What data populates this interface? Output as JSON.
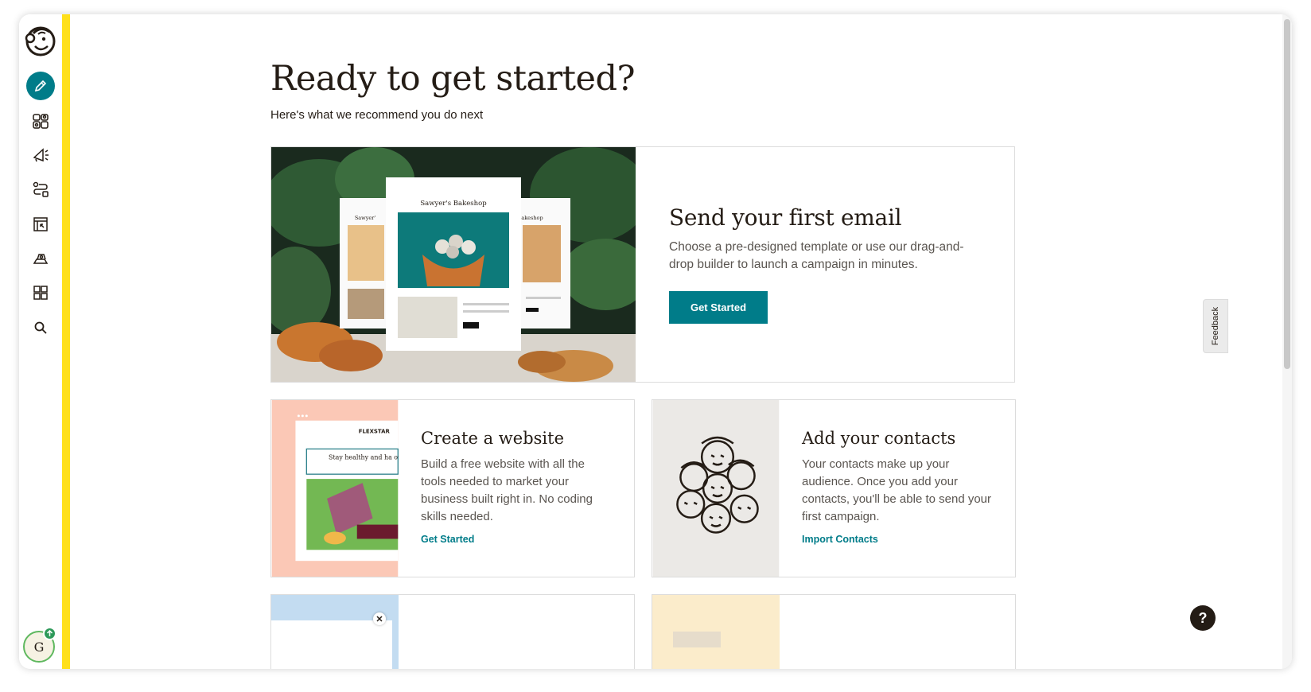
{
  "header": {
    "title": "Ready to get started?",
    "subtitle": "Here's what we recommend you do next"
  },
  "hero": {
    "title": "Send your first email",
    "description": "Choose a pre-designed template or use our drag-and-drop builder to launch a campaign in minutes.",
    "button": "Get Started",
    "image_caption": "Sawyer's Bakeshop",
    "image_side_left": "Sawyer'",
    "image_side_right": "akeshop"
  },
  "cards": [
    {
      "title": "Create a website",
      "description": "Build a free website with all the tools needed to market your business built right in. No coding skills needed.",
      "link": "Get Started",
      "image_brand": "FLEXSTAR",
      "image_text": "Stay healthy and ha our program"
    },
    {
      "title": "Add your contacts",
      "description": "Your contacts make up your audience. Once you add your contacts, you'll be able to send your first campaign.",
      "link": "Import Contacts"
    }
  ],
  "sidebar": {
    "items": [
      {
        "name": "create-icon",
        "active": true
      },
      {
        "name": "audience-icon"
      },
      {
        "name": "campaigns-icon"
      },
      {
        "name": "automations-icon"
      },
      {
        "name": "website-icon"
      },
      {
        "name": "content-icon"
      },
      {
        "name": "integrations-icon"
      },
      {
        "name": "search-icon"
      }
    ],
    "avatar_initial": "G"
  },
  "feedback_label": "Feedback",
  "help_label": "?",
  "colors": {
    "accent": "#007c89",
    "brand_yellow": "#ffe01b",
    "text": "#241c15"
  }
}
